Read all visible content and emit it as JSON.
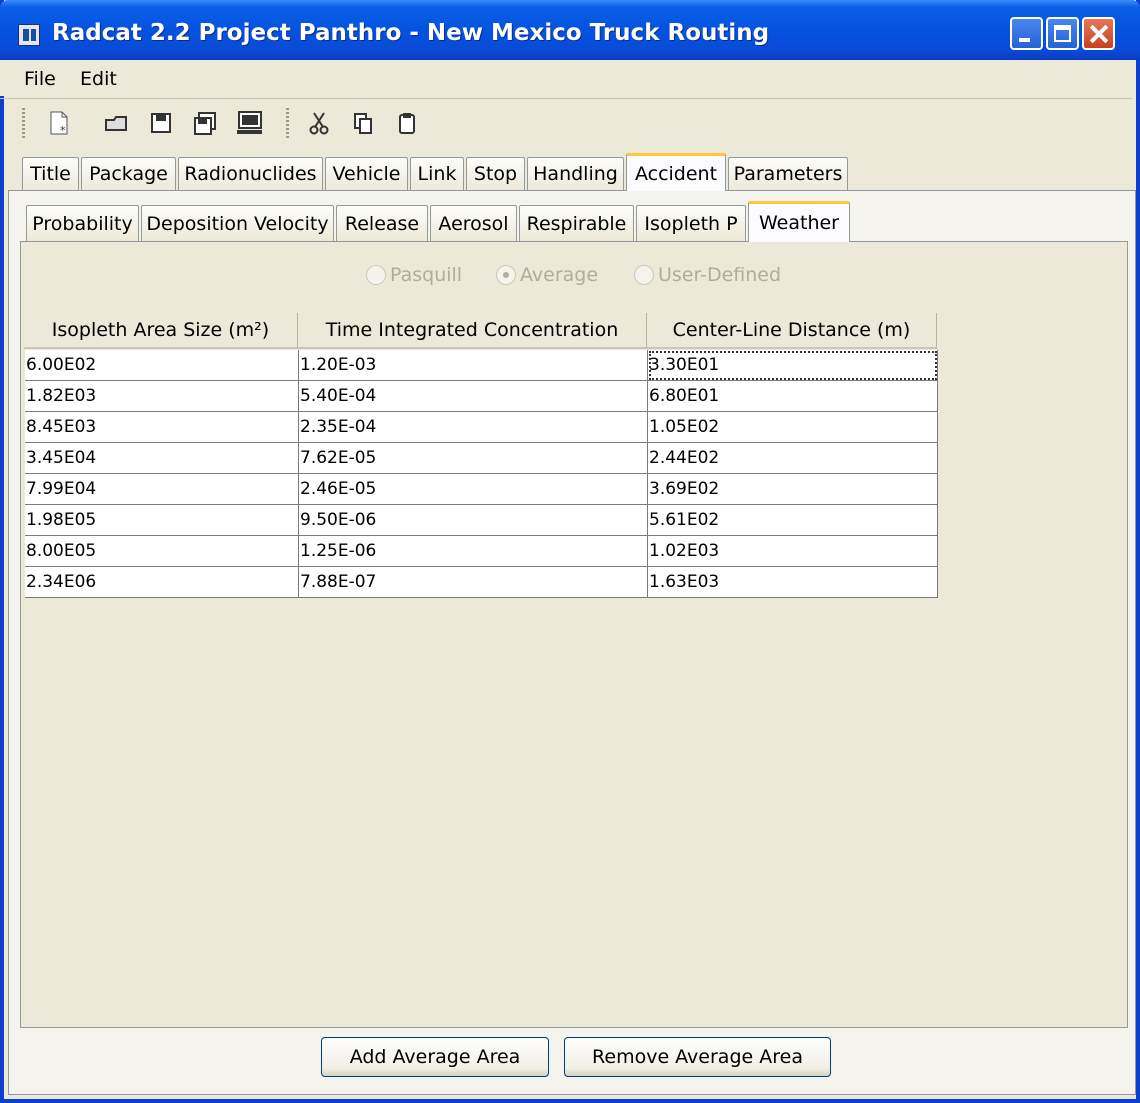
{
  "window": {
    "title": "Radcat 2.2 Project Panthro - New Mexico Truck Routing"
  },
  "menu": [
    "File",
    "Edit"
  ],
  "toolbar": [
    "new-file-icon",
    "open-folder-icon",
    "save-icon",
    "save-all-icon",
    "computer-icon",
    "cut-icon",
    "copy-icon",
    "paste-icon"
  ],
  "main_tabs": [
    "Title",
    "Package",
    "Radionuclides",
    "Vehicle",
    "Link",
    "Stop",
    "Handling",
    "Accident",
    "Parameters"
  ],
  "main_tab_active": "Accident",
  "sub_tabs": [
    "Probability",
    "Deposition Velocity",
    "Release",
    "Aerosol",
    "Respirable",
    "Isopleth P",
    "Weather"
  ],
  "sub_tab_active": "Weather",
  "radios": [
    {
      "label": "Pasquill",
      "selected": false,
      "enabled": false
    },
    {
      "label": "Average",
      "selected": true,
      "enabled": false
    },
    {
      "label": "User-Defined",
      "selected": false,
      "enabled": false
    }
  ],
  "table": {
    "columns": [
      "Isopleth Area Size (m²)",
      "Time Integrated Concentration",
      "Center-Line Distance (m)"
    ],
    "rows": [
      [
        "6.00E02",
        "1.20E-03",
        "3.30E01"
      ],
      [
        "1.82E03",
        "5.40E-04",
        "6.80E01"
      ],
      [
        "8.45E03",
        "2.35E-04",
        "1.05E02"
      ],
      [
        "3.45E04",
        "7.62E-05",
        "2.44E02"
      ],
      [
        "7.99E04",
        "2.46E-05",
        "3.69E02"
      ],
      [
        "1.98E05",
        "9.50E-06",
        "5.61E02"
      ],
      [
        "8.00E05",
        "1.25E-06",
        "1.02E03"
      ],
      [
        "2.34E06",
        "7.88E-07",
        "1.63E03"
      ]
    ]
  },
  "buttons": {
    "add": "Add Average Area",
    "remove": "Remove Average Area"
  }
}
